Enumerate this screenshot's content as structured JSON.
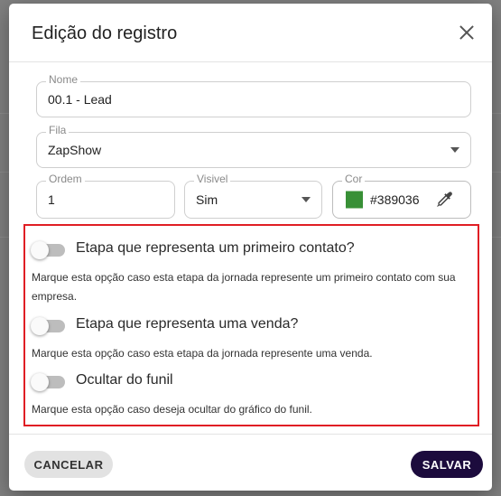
{
  "dialog": {
    "title": "Edição do registro",
    "close_icon": "close-icon"
  },
  "form": {
    "nome": {
      "label": "Nome",
      "value": "00.1 - Lead"
    },
    "fila": {
      "label": "Fila",
      "value": "ZapShow"
    },
    "ordem": {
      "label": "Ordem",
      "value": "1"
    },
    "visivel": {
      "label": "Visivel",
      "value": "Sim"
    },
    "cor": {
      "label": "Cor",
      "value": "#389036",
      "swatch_color": "#389036",
      "picker_icon": "eyedropper-icon"
    }
  },
  "options": [
    {
      "title": "Etapa que representa um primeiro contato?",
      "description": "Marque esta opção caso esta etapa da jornada represente um primeiro contato com sua empresa.",
      "enabled": false
    },
    {
      "title": "Etapa que representa uma venda?",
      "description": "Marque esta opção caso esta etapa da jornada represente uma venda.",
      "enabled": false
    },
    {
      "title": "Ocultar do funil",
      "description": "Marque esta opção caso deseja ocultar do gráfico do funil.",
      "enabled": false
    }
  ],
  "footer": {
    "cancel_label": "CANCELAR",
    "save_label": "SALVAR"
  },
  "colors": {
    "highlight_border": "#e01e24",
    "save_button_bg": "#1c0b3d"
  }
}
